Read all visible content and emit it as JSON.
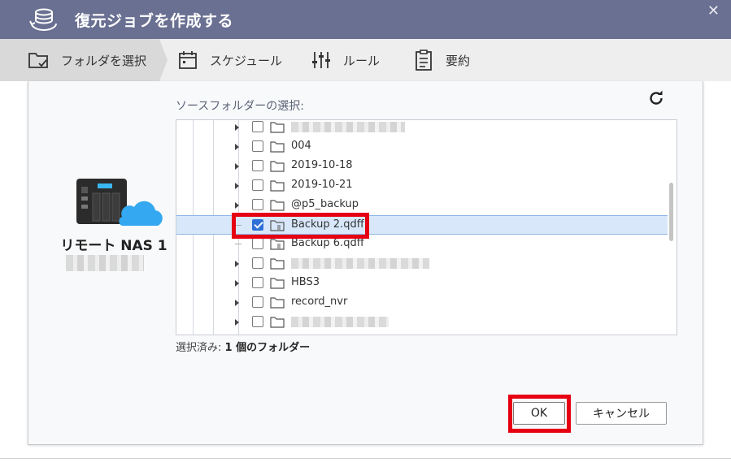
{
  "window": {
    "title": "復元ジョブを作成する",
    "close_glyph": "✕"
  },
  "steps": [
    {
      "label": "フォルダを選択",
      "icon": "folder-check-icon",
      "active": true
    },
    {
      "label": "スケジュール",
      "icon": "calendar-icon",
      "active": false
    },
    {
      "label": "ルール",
      "icon": "sliders-icon",
      "active": false
    },
    {
      "label": "要約",
      "icon": "clipboard-icon",
      "active": false
    }
  ],
  "device": {
    "name": "リモート NAS 1",
    "icon": "nas-cloud-icon"
  },
  "source": {
    "label": "ソースフォルダーの選択:",
    "refresh_icon": "refresh-icon",
    "rows": [
      {
        "label": "",
        "blurred": true,
        "expander": "arrow",
        "checked": false,
        "icon": "folder-icon"
      },
      {
        "label": "004",
        "blurred": false,
        "expander": "arrow",
        "checked": false,
        "icon": "folder-icon"
      },
      {
        "label": "2019-10-18",
        "blurred": false,
        "expander": "arrow",
        "checked": false,
        "icon": "folder-icon"
      },
      {
        "label": "2019-10-21",
        "blurred": false,
        "expander": "arrow",
        "checked": false,
        "icon": "folder-icon"
      },
      {
        "label": "@p5_backup",
        "blurred": false,
        "expander": "arrow",
        "checked": false,
        "icon": "folder-icon"
      },
      {
        "label": "Backup 2.qdff",
        "blurred": false,
        "expander": "dash",
        "checked": true,
        "selected": true,
        "icon": "backup-file-icon"
      },
      {
        "label": "Backup 6.qdff",
        "blurred": false,
        "expander": "dash",
        "checked": false,
        "icon": "backup-file-icon"
      },
      {
        "label": "",
        "blurred": true,
        "expander": "arrow",
        "checked": false,
        "icon": "folder-icon"
      },
      {
        "label": "HBS3",
        "blurred": false,
        "expander": "arrow",
        "checked": false,
        "icon": "folder-icon"
      },
      {
        "label": "record_nvr",
        "blurred": false,
        "expander": "arrow",
        "checked": false,
        "icon": "folder-icon"
      },
      {
        "label": "",
        "blurred": true,
        "expander": "arrow",
        "checked": false,
        "icon": "folder-icon"
      }
    ]
  },
  "status": {
    "prefix": "選択済み: ",
    "value": "1 個のフォルダー"
  },
  "buttons": {
    "ok": "OK",
    "cancel": "キャンセル"
  },
  "colors": {
    "titlebar": "#6a7092",
    "highlight": "#e60012",
    "checkbox_checked": "#2f6fd6",
    "row_selected": "#d8e8fa"
  }
}
